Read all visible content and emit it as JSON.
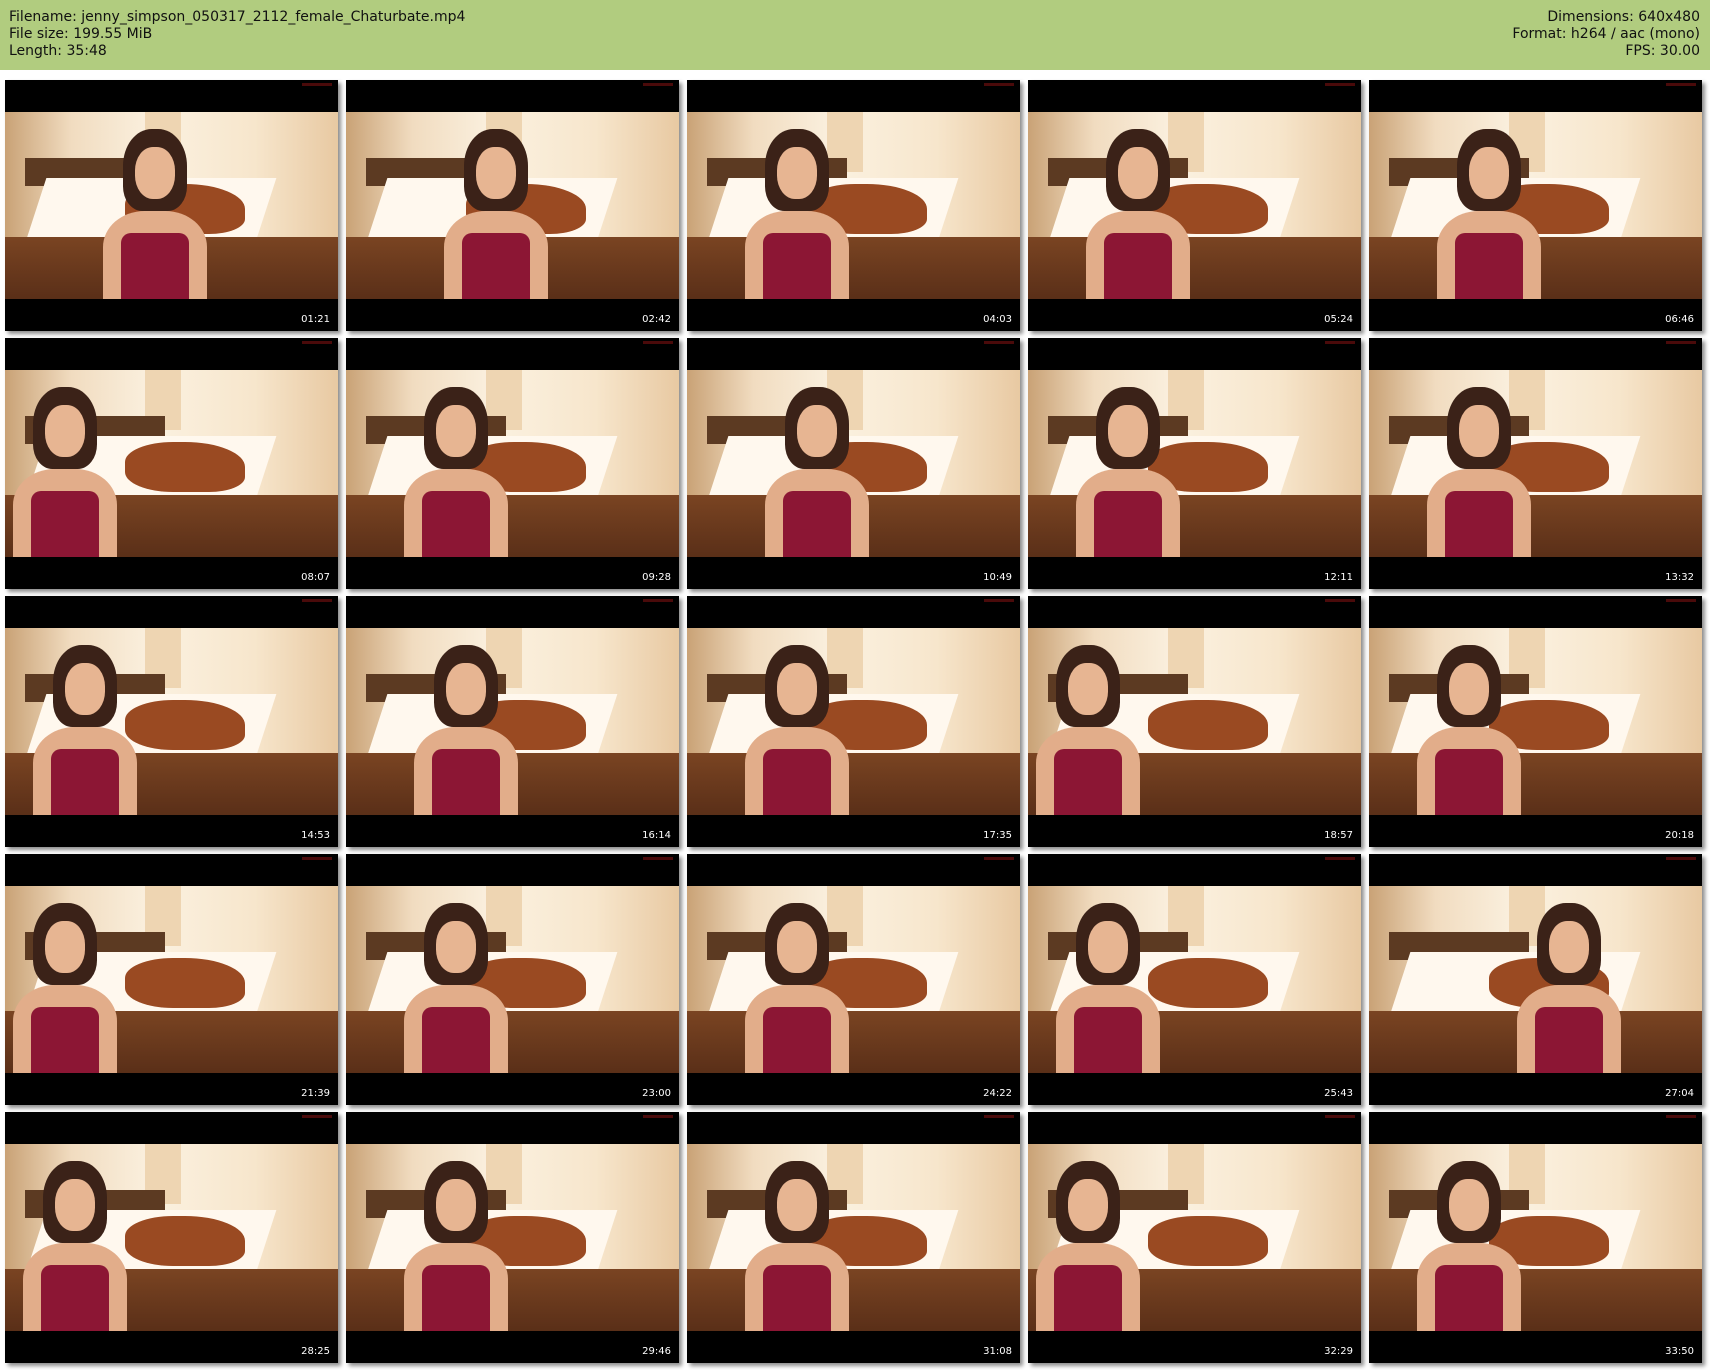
{
  "header": {
    "filename": "Filename:  jenny_simpson_050317_2112_female_Chaturbate.mp4",
    "file_size": "File size: 199.55 MiB",
    "length": "Length: 35:48",
    "dimensions": "Dimensions: 640x480",
    "format": "Format: h264 / aac (mono)",
    "fps": "FPS: 30.00"
  },
  "thumbnails": [
    "01:21",
    "02:42",
    "04:03",
    "05:24",
    "06:46",
    "08:07",
    "09:28",
    "10:49",
    "12:11",
    "13:32",
    "14:53",
    "16:14",
    "17:35",
    "18:57",
    "20:18",
    "21:39",
    "23:00",
    "24:22",
    "25:43",
    "27:04",
    "28:25",
    "29:46",
    "31:08",
    "32:29",
    "33:50"
  ],
  "colors": {
    "header_bg": "#b1cc7f",
    "frame": "#000000"
  }
}
